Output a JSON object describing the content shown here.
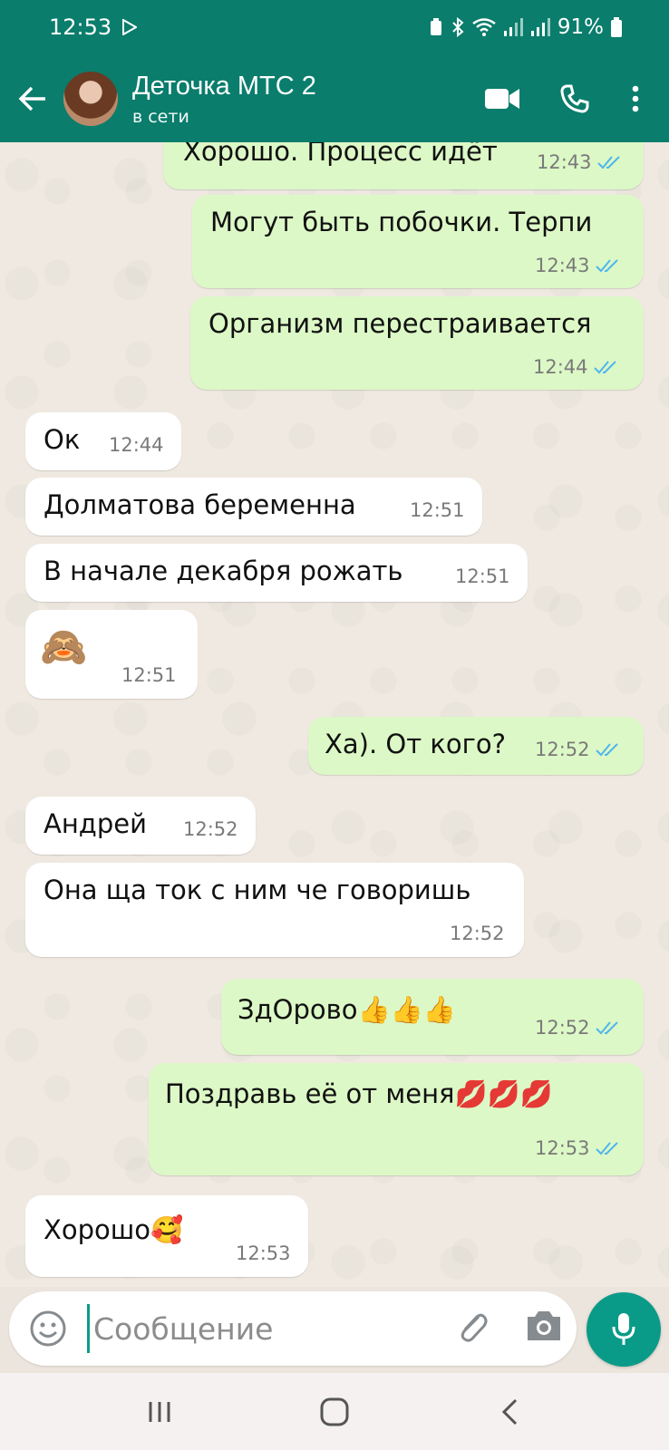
{
  "status_bar": {
    "time": "12:53",
    "battery": "91%"
  },
  "app_bar": {
    "contact_name": "Деточка МТС 2",
    "contact_status": "в сети"
  },
  "messages": [
    {
      "text": "Хорошо. Процесс идёт",
      "time": "12:43",
      "direction": "out",
      "read": true
    },
    {
      "text": "Могут быть побочки. Терпи",
      "time": "12:43",
      "direction": "out",
      "read": true
    },
    {
      "text": "Организм перестраивается",
      "time": "12:44",
      "direction": "out",
      "read": true
    },
    {
      "text": "Ок",
      "time": "12:44",
      "direction": "in"
    },
    {
      "text": "Долматова беременна",
      "time": "12:51",
      "direction": "in"
    },
    {
      "text": "В начале декабря рожать",
      "time": "12:51",
      "direction": "in"
    },
    {
      "text": "🙈",
      "time": "12:51",
      "direction": "in"
    },
    {
      "text": "Ха). От кого?",
      "time": "12:52",
      "direction": "out",
      "read": true
    },
    {
      "text": "Андрей",
      "time": "12:52",
      "direction": "in"
    },
    {
      "text": "Она ща ток с ним че говоришь",
      "time": "12:52",
      "direction": "in"
    },
    {
      "text": "ЗдОрово👍👍👍",
      "time": "12:52",
      "direction": "out",
      "read": true
    },
    {
      "text": "Поздравь её от меня💋💋💋",
      "time": "12:53",
      "direction": "out",
      "read": true
    },
    {
      "text": "Хорошо🥰",
      "time": "12:53",
      "direction": "in"
    }
  ],
  "composer": {
    "placeholder": "Сообщение"
  },
  "colors": {
    "header": "#0a7d6c",
    "outgoing_bubble": "#dcf8c6",
    "incoming_bubble": "#ffffff",
    "read_ticks": "#4fb6ec",
    "mic_button": "#0a9b88"
  }
}
